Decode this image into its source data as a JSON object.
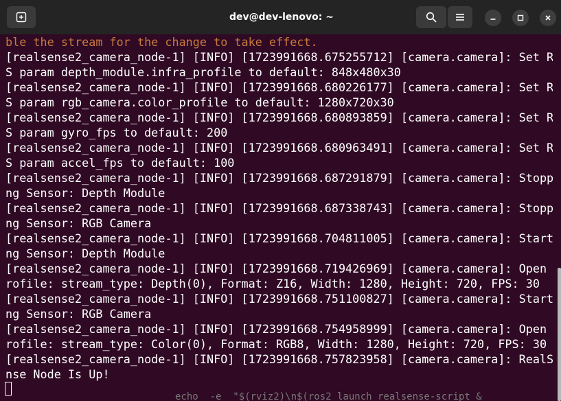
{
  "window": {
    "title": "dev@dev-lenovo: ~",
    "icons": {
      "new_tab": "new-tab-icon",
      "search": "search-icon",
      "menu": "hamburger-menu-icon",
      "minimize": "minimize-icon",
      "maximize": "maximize-icon",
      "close": "close-icon"
    }
  },
  "colors": {
    "terminal_background": "#300a24",
    "titlebar_background": "#242424",
    "text": "#ffffff",
    "warning_text": "#c77a40"
  },
  "terminal": {
    "lines": [
      "ble the stream for the change to take effect.",
      "[realsense2_camera_node-1] [INFO] [1723991668.675255712] [camera.camera]: Set RO",
      "S param depth_module.infra_profile to default: 848x480x30",
      "[realsense2_camera_node-1] [INFO] [1723991668.680226177] [camera.camera]: Set RO",
      "S param rgb_camera.color_profile to default: 1280x720x30",
      "[realsense2_camera_node-1] [INFO] [1723991668.680893859] [camera.camera]: Set RO",
      "S param gyro_fps to default: 200",
      "[realsense2_camera_node-1] [INFO] [1723991668.680963491] [camera.camera]: Set RO",
      "S param accel_fps to default: 100",
      "[realsense2_camera_node-1] [INFO] [1723991668.687291879] [camera.camera]: Stoppi",
      "ng Sensor: Depth Module",
      "[realsense2_camera_node-1] [INFO] [1723991668.687338743] [camera.camera]: Stoppi",
      "ng Sensor: RGB Camera",
      "[realsense2_camera_node-1] [INFO] [1723991668.704811005] [camera.camera]: Starti",
      "ng Sensor: Depth Module",
      "[realsense2_camera_node-1] [INFO] [1723991668.719426969] [camera.camera]: Open p",
      "rofile: stream_type: Depth(0), Format: Z16, Width: 1280, Height: 720, FPS: 30",
      "[realsense2_camera_node-1] [INFO] [1723991668.751100827] [camera.camera]: Starti",
      "ng Sensor: RGB Camera",
      "[realsense2_camera_node-1] [INFO] [1723991668.754958999] [camera.camera]: Open p",
      "rofile: stream_type: Color(0), Format: RGB8, Width: 1280, Height: 720, FPS: 30",
      "[realsense2_camera_node-1] [INFO] [1723991668.757823958] [camera.camera]: RealSe",
      "nse Node Is Up!"
    ]
  },
  "background_window": {
    "partial_text": "echo  -e  \"$(rviz2)\\n$(ros2 launch realsense-script &"
  }
}
